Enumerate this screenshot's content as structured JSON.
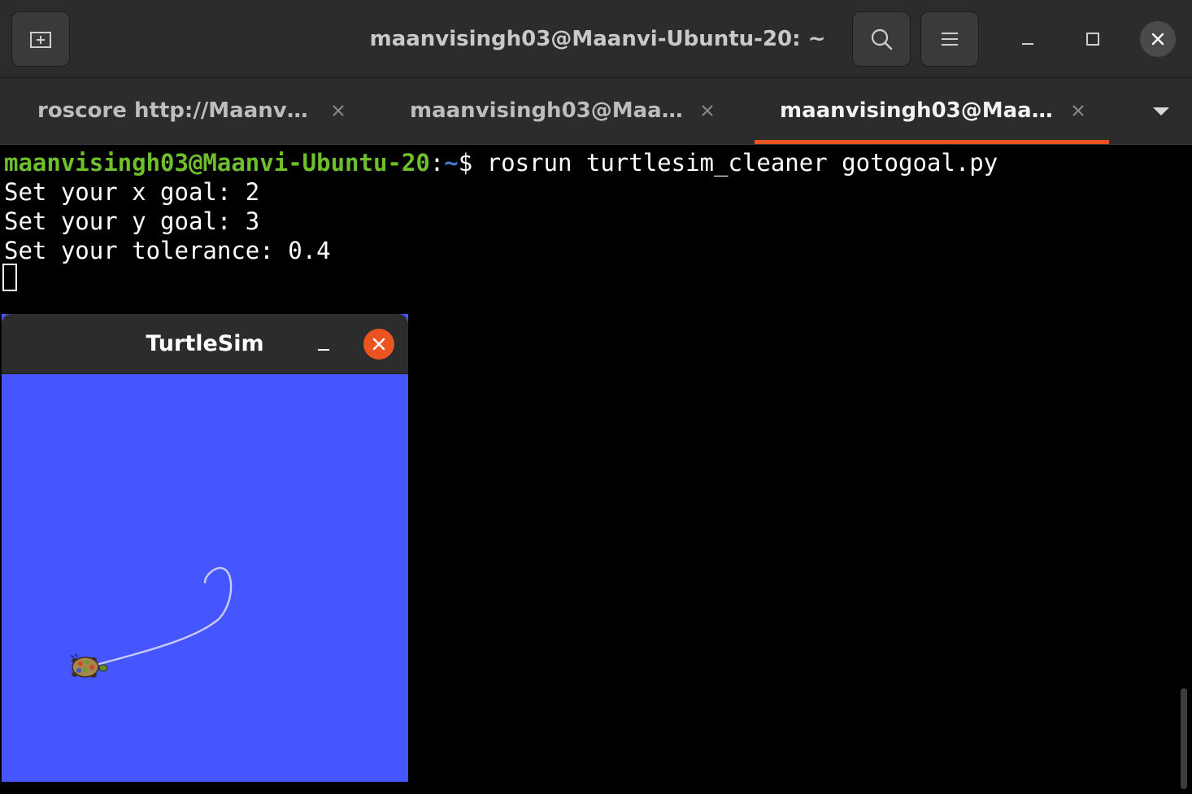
{
  "titlebar": {
    "title": "maanvisingh03@Maanvi-Ubuntu-20: ~",
    "new_tab_icon": "new-tab-icon",
    "search_icon": "search-icon",
    "menu_icon": "hamburger-menu-icon"
  },
  "tabs": [
    {
      "label": "roscore http://Maanv…",
      "active": false
    },
    {
      "label": "maanvisingh03@Maa…",
      "active": false
    },
    {
      "label": "maanvisingh03@Maa…",
      "active": true
    }
  ],
  "terminal": {
    "prompt_user": "maanvisingh03@Maanvi-Ubuntu-20",
    "prompt_colon": ":",
    "prompt_path": "~",
    "prompt_symbol": "$",
    "command": " rosrun turtlesim_cleaner gotogoal.py",
    "output": [
      "Set your x goal: 2",
      "Set your y goal: 3",
      "Set your tolerance: 0.4"
    ]
  },
  "turtlesim": {
    "title": "TurtleSim",
    "background_color": "#4556ff",
    "trail_color": "#c8ccf5"
  },
  "colors": {
    "accent": "#e95420",
    "prompt_user": "#6fbf2d",
    "prompt_path": "#3d7bd9"
  }
}
